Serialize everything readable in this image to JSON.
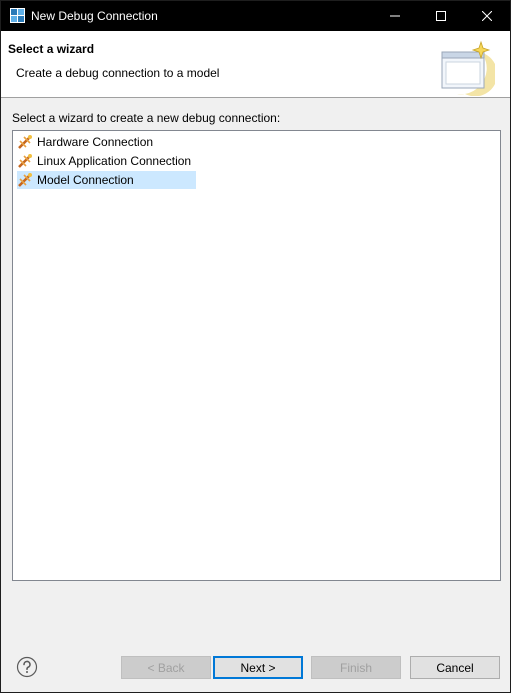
{
  "window": {
    "title": "New Debug Connection",
    "controls": {
      "minimize": "minimize",
      "maximize": "maximize",
      "close": "close"
    }
  },
  "banner": {
    "title": "Select a wizard",
    "description": "Create a debug connection to a model",
    "icon": "wizard-banner-icon"
  },
  "main": {
    "instruction": "Select a wizard to create a new debug connection:",
    "items": [
      {
        "label": "Hardware Connection",
        "icon": "debug-connection-icon",
        "selected": false
      },
      {
        "label": "Linux Application Connection",
        "icon": "debug-connection-icon",
        "selected": false
      },
      {
        "label": "Model Connection",
        "icon": "debug-connection-icon",
        "selected": true
      }
    ]
  },
  "footer": {
    "help_icon": "help-icon",
    "back_label": "< Back",
    "next_label": "Next >",
    "finish_label": "Finish",
    "cancel_label": "Cancel"
  },
  "colors": {
    "titlebar": "#000000",
    "selection": "#cce8ff",
    "default_button_border": "#0078d7",
    "disabled_text": "#a0a0a0"
  }
}
